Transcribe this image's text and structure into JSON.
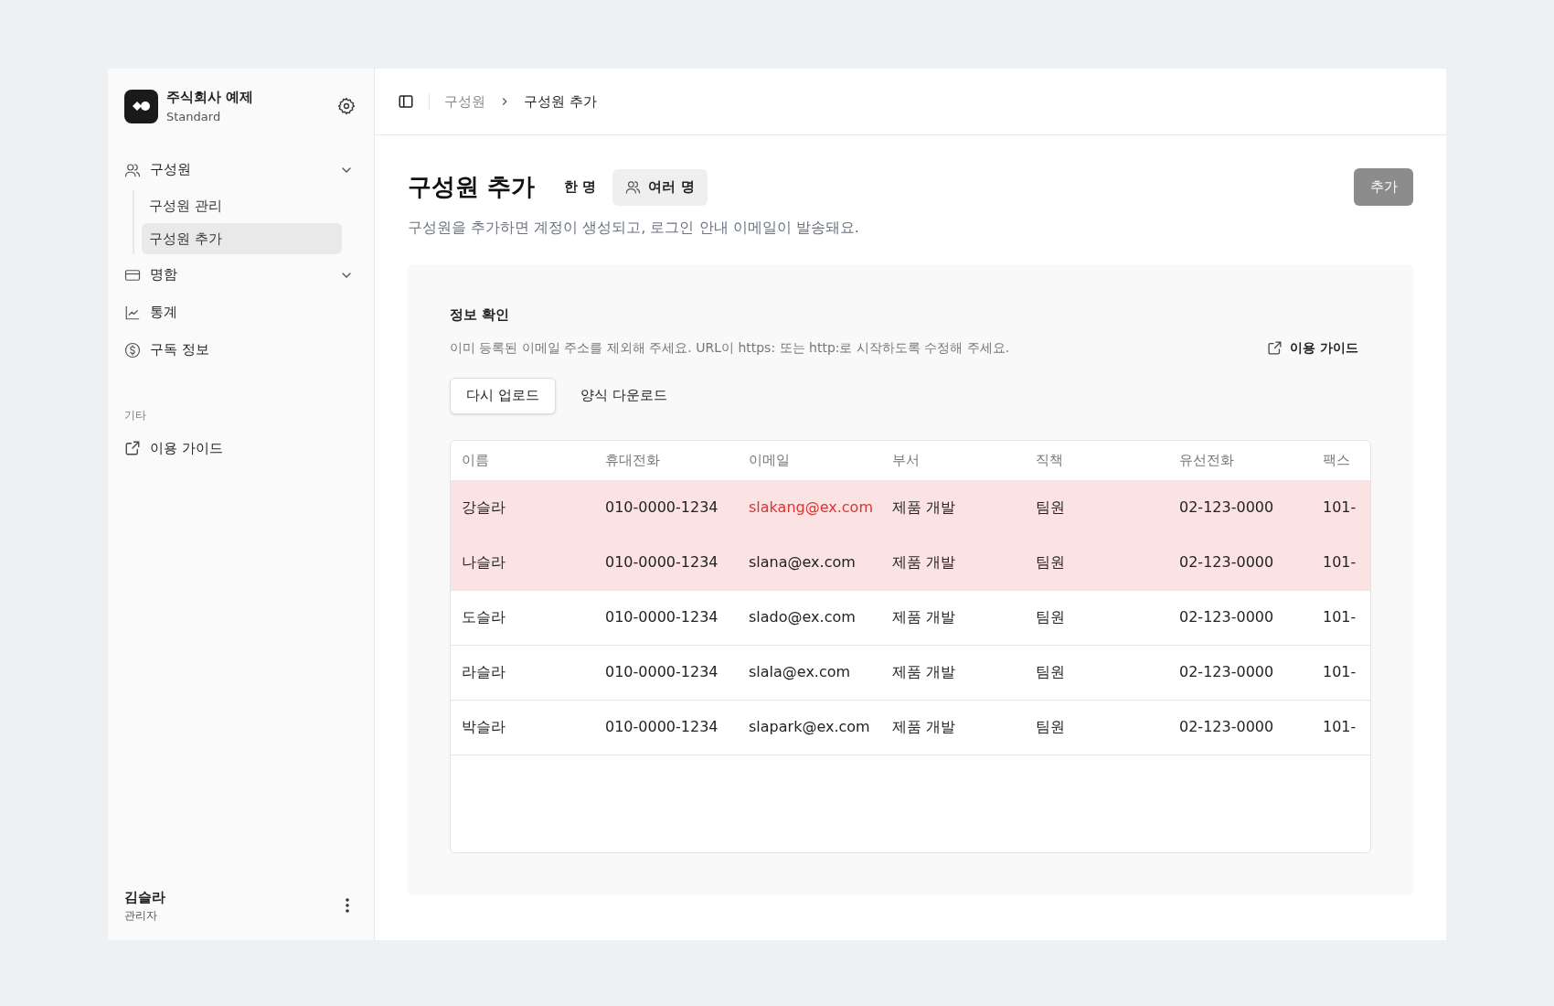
{
  "workspace": {
    "name": "주식회사 예제",
    "plan": "Standard"
  },
  "nav": [
    {
      "label": "구성원",
      "kind": "group",
      "expanded": true,
      "children": [
        {
          "label": "구성원 관리",
          "selected": false
        },
        {
          "label": "구성원 추가",
          "selected": true
        }
      ]
    },
    {
      "label": "명함",
      "kind": "group"
    },
    {
      "label": "통계",
      "kind": "link"
    },
    {
      "label": "구독 정보",
      "kind": "link"
    }
  ],
  "other_section": {
    "title": "기타",
    "items": [
      {
        "label": "이용 가이드"
      }
    ]
  },
  "user": {
    "name": "김슬라",
    "role": "관리자"
  },
  "breadcrumb": [
    "구성원",
    "구성원 추가"
  ],
  "page": {
    "title": "구성원 추가",
    "modes": [
      {
        "label": "한 명",
        "selected": false
      },
      {
        "label": "여러 명",
        "selected": true
      }
    ],
    "add_button": {
      "label": "추가",
      "disabled": true
    },
    "description": "구성원을 추가하면 계정이 생성되고, 로그인 안내 이메일이 발송돼요."
  },
  "review": {
    "title": "정보 확인",
    "hint": "이미 등록된 이메일 주소를 제외해 주세요. URL이 https: 또는 http:로 시작하도록 수정해 주세요.",
    "guide_link": "이용 가이드",
    "buttons": [
      {
        "label": "다시 업로드",
        "kind": "outline"
      },
      {
        "label": "양식 다운로드",
        "kind": "ghost"
      }
    ]
  },
  "table": {
    "columns": [
      "이름",
      "휴대전화",
      "이메일",
      "부서",
      "직책",
      "유선전화",
      "팩스"
    ],
    "rows": [
      {
        "error": true,
        "email_error": true,
        "cells": [
          "강슬라",
          "010-0000-1234",
          "slakang@ex.com",
          "제품 개발",
          "팀원",
          "02-123-0000",
          "101-"
        ]
      },
      {
        "error": true,
        "email_error": false,
        "cells": [
          "나슬라",
          "010-0000-1234",
          "slana@ex.com",
          "제품 개발",
          "팀원",
          "02-123-0000",
          "101-"
        ]
      },
      {
        "error": false,
        "email_error": false,
        "cells": [
          "도슬라",
          "010-0000-1234",
          "slado@ex.com",
          "제품 개발",
          "팀원",
          "02-123-0000",
          "101-"
        ]
      },
      {
        "error": false,
        "email_error": false,
        "cells": [
          "라슬라",
          "010-0000-1234",
          "slala@ex.com",
          "제품 개발",
          "팀원",
          "02-123-0000",
          "101-"
        ]
      },
      {
        "error": false,
        "email_error": false,
        "cells": [
          "박슬라",
          "010-0000-1234",
          "slapark@ex.com",
          "제품 개발",
          "팀원",
          "02-123-0000",
          "101-"
        ]
      }
    ]
  }
}
